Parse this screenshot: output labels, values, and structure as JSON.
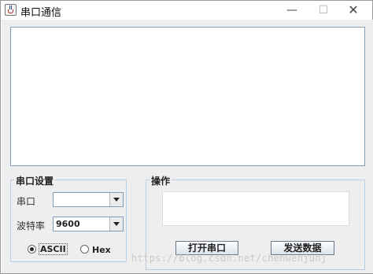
{
  "window": {
    "title": "串口通信",
    "minimize_label": "—",
    "maximize_label": "☐",
    "close_label": "✕"
  },
  "serial_settings": {
    "group_title": "串口设置",
    "port_label": "串口",
    "port_value": "",
    "baud_label": "波特率",
    "baud_value": "9600",
    "ascii_label": "ASCII",
    "hex_label": "Hex",
    "selected_mode": "ASCII"
  },
  "operations": {
    "group_title": "操作",
    "send_field_value": "",
    "open_port_label": "打开串口",
    "send_data_label": "发送数据"
  },
  "watermark": "https://blog.csdn.net/chenwenjunj"
}
